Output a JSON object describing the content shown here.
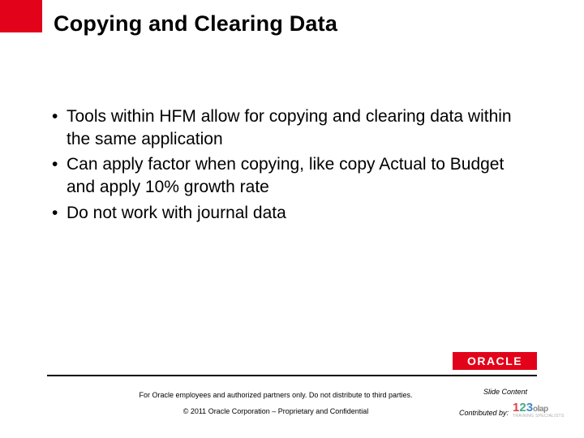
{
  "title": "Copying and Clearing Data",
  "bullets": [
    "Tools within HFM allow for copying and clearing data within the same application",
    "Can apply factor when copying, like copy Actual to Budget and apply 10% growth rate",
    "Do not work with journal data"
  ],
  "footer": {
    "disclaimer": "For Oracle employees and authorized partners only. Do not distribute to third parties.",
    "copyright": "© 2011 Oracle Corporation – Proprietary and Confidential",
    "slide_content_label": "Slide Content",
    "contributed_by_label": "Contributed by:"
  },
  "logos": {
    "oracle": "ORACLE",
    "contrib_num": "123",
    "contrib_word": "olap",
    "contrib_sub": "TRAINING SPECIALISTS"
  }
}
